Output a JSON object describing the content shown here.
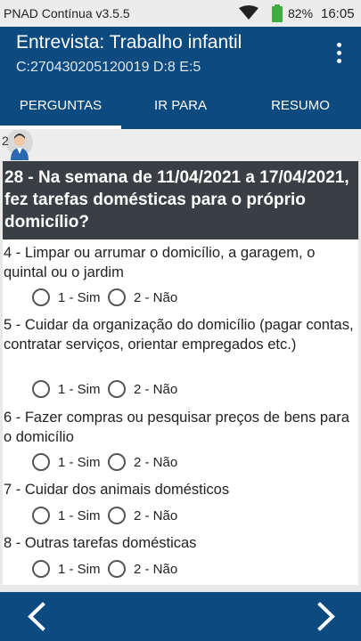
{
  "status": {
    "app_name": "PNAD Contínua v3.5.5",
    "battery": "82%",
    "time": "16:05"
  },
  "appbar": {
    "title": "Entrevista: Trabalho infantil",
    "subtitle": "C:270430205120019 D:8 E:5",
    "menu_icon": "more-vert-icon"
  },
  "tabs": [
    {
      "label": "PERGUNTAS",
      "active": true
    },
    {
      "label": "IR PARA",
      "active": false
    },
    {
      "label": "RESUMO",
      "active": false
    }
  ],
  "avatar_number": "2",
  "question": {
    "text": "28 - Na semana de 11/04/2021 a 17/04/2021, fez tarefas domésticas para o próprio domicílio?",
    "items": [
      {
        "label": "4 - Limpar ou arrumar o domicílio, a garagem, o quintal ou o jardim"
      },
      {
        "label": "5 - Cuidar da organização do domicílio (pagar contas, contratar serviços, orientar empregados etc.)"
      },
      {
        "label": "6 - Fazer compras ou pesquisar preços de bens para o domicílio"
      },
      {
        "label": "7 - Cuidar dos animais domésticos"
      },
      {
        "label": "8 - Outras tarefas domésticas"
      }
    ],
    "option_yes": "1 - Sim",
    "option_no": "2 - Não"
  },
  "colors": {
    "primary": "#0d4a80",
    "question_header": "#393f44"
  }
}
